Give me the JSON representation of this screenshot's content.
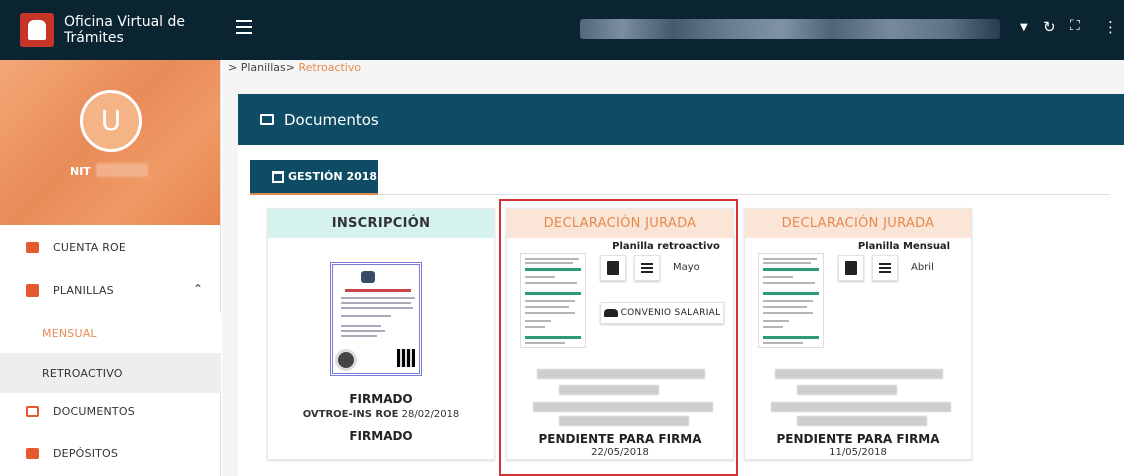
{
  "app": {
    "title": "Oficina Virtual de Trámites"
  },
  "topbar": {
    "refresh_icon": "refresh-icon",
    "fullscreen_icon": "fullscreen-icon",
    "more_icon": "more-vert-icon"
  },
  "sidebar": {
    "avatar_letter": "U",
    "nit_label": "NIT",
    "items": [
      {
        "label": "CUENTA ROE"
      },
      {
        "label": "PLANILLAS"
      },
      {
        "label": "MENSUAL"
      },
      {
        "label": "RETROACTIVO"
      },
      {
        "label": "DOCUMENTOS"
      },
      {
        "label": "DEPÓSITOS"
      }
    ]
  },
  "breadcrumb": {
    "sep1": ">",
    "item1": "Planillas",
    "sep2": ">",
    "current": "Retroactivo"
  },
  "panel": {
    "title": "Documentos",
    "tab": "GESTIÓN 2018"
  },
  "cards": [
    {
      "header": "INSCRIPCIÓN",
      "status1": "FIRMADO",
      "code_label": "OVTROE-INS ROE",
      "code_date": "28/02/2018",
      "status2": "FIRMADO"
    },
    {
      "header": "DECLARACIÓN JURADA",
      "planilla": "Planilla retroactivo",
      "month": "Mayo",
      "convenio": "CONVENIO SALARIAL",
      "status": "PENDIENTE PARA FIRMA",
      "date": "22/05/2018"
    },
    {
      "header": "DECLARACIÓN JURADA",
      "planilla": "Planilla Mensual",
      "month": "Abril",
      "status": "PENDIENTE PARA FIRMA",
      "date": "11/05/2018"
    }
  ],
  "colors": {
    "topbar": "#0b2431",
    "panel_header": "#0e4b64",
    "accent": "#e58a4f",
    "highlight_border": "#d63232"
  }
}
